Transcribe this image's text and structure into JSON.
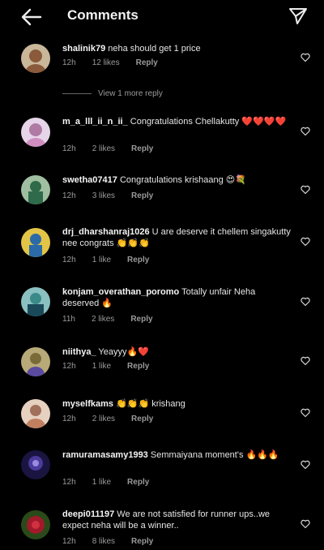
{
  "header": {
    "title": "Comments",
    "back_icon": "back-arrow-icon",
    "send_icon": "send-icon"
  },
  "comments": [
    {
      "username": "shalinik79",
      "text": " neha should get 1 price",
      "time": "12h",
      "likes": "12 likes",
      "reply": "Reply",
      "more": "View 1 more reply",
      "avatar_color": "#8a5a3a"
    },
    {
      "username": "m_a_lll_ii_n_ii_",
      "text": " Congratulations Chellakutty ❤️❤️❤️❤️",
      "time": "12h",
      "likes": "2 likes",
      "reply": "Reply",
      "avatar_color": "#b07aa5"
    },
    {
      "username": "swetha07417",
      "text": " Congratulations krishaang 😍💐",
      "time": "12h",
      "likes": "3 likes",
      "reply": "Reply",
      "avatar_color": "#2f6b4a"
    },
    {
      "username": "drj_dharshanraj1026",
      "text": " U are deserve it chellem singakutty nee congrats 👏👏👏",
      "time": "12h",
      "likes": "1 like",
      "reply": "Reply",
      "avatar_color": "#2a6aa8"
    },
    {
      "username": "konjam_overathan_poromo",
      "text": " Totally unfair Neha deserved 🔥",
      "time": "11h",
      "likes": "2 likes",
      "reply": "Reply",
      "avatar_color": "#3a8a8a"
    },
    {
      "username": "niithya_",
      "text": " Yeayyy🔥❤️",
      "time": "12h",
      "likes": "1 like",
      "reply": "Reply",
      "avatar_color": "#7a6a3a"
    },
    {
      "username": "myselfkams",
      "text": " 👏👏👏 krishang",
      "time": "12h",
      "likes": "2 likes",
      "reply": "Reply",
      "avatar_color": "#a0705a"
    },
    {
      "username": "ramuramasamy1993",
      "text": " Semmaiyana moment's 🔥🔥🔥",
      "time": "12h",
      "likes": "1 like",
      "reply": "Reply",
      "avatar_color": "#4a3a9a"
    },
    {
      "username": "deepi011197",
      "text": " We are not satisfied for runner ups..we expect neha will be a winner..",
      "time": "12h",
      "likes": "8 likes",
      "reply": "Reply",
      "avatar_color": "#a01a2a"
    }
  ]
}
